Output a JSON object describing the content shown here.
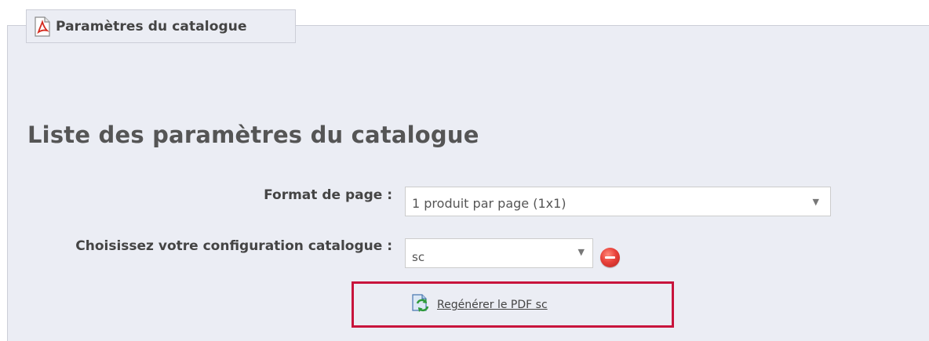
{
  "panel": {
    "legend_title": "Paramètres du catalogue",
    "legend_icon": "pdf-icon"
  },
  "main": {
    "heading": "Liste des paramètres du catalogue",
    "fields": {
      "format": {
        "label": "Format de page :",
        "selected": "1 produit par page (1x1)"
      },
      "config": {
        "label": "Choisissez votre configuration catalogue :",
        "selected": "sc",
        "remove_icon": "remove-circle-icon"
      }
    },
    "regenerate": {
      "label": "Regénérer le PDF sc",
      "icon": "refresh-document-icon"
    },
    "highlight_color": "#c8143c"
  }
}
